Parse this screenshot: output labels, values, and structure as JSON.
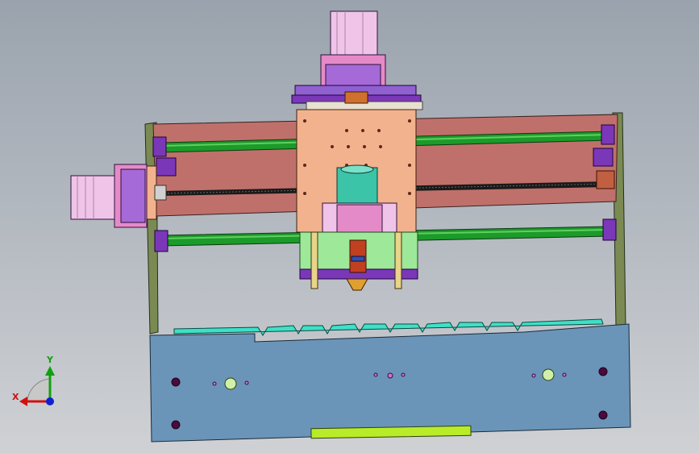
{
  "viewport": {
    "background_top": "#9aa3ad",
    "background_bottom": "#cfd1d4"
  },
  "triad": {
    "x_label": "X",
    "y_label": "Y",
    "x_color": "#d01010",
    "y_color": "#10a010",
    "z_color": "#1020d0"
  },
  "model": {
    "rod_color": "#1c9a2a",
    "gantry_color": "#f2b28e",
    "base_plate_color": "#6a95b8",
    "teeth_strip_color": "#3fe0c8",
    "rear_panel_color": "#c0706a",
    "motor_color": "#f0c4e8",
    "spindle_color": "#3cc4a8",
    "bracket_color": "#7a38b8",
    "accent_strip_color": "#b8ec28"
  }
}
